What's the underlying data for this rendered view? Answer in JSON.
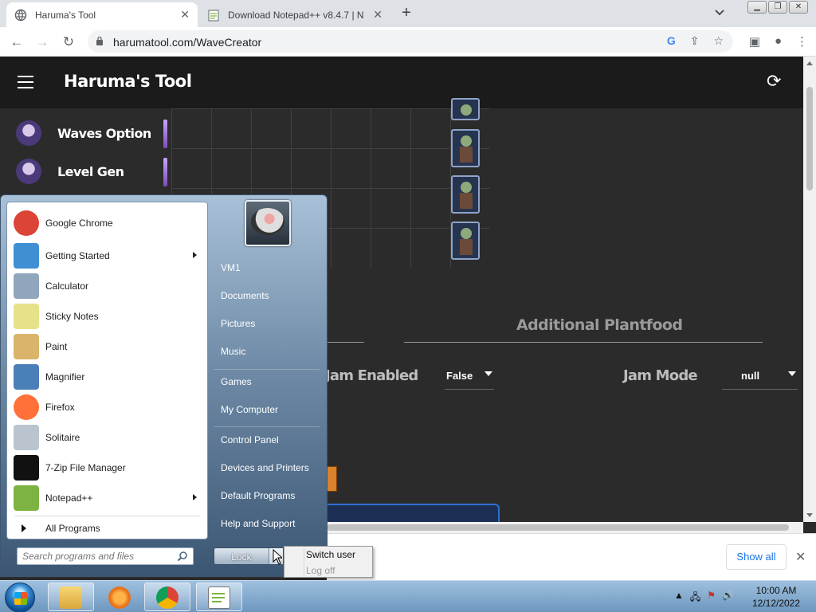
{
  "browser": {
    "tabs": [
      {
        "title": "Haruma's Tool",
        "active": true
      },
      {
        "title": "Download Notepad++ v8.4.7 | N",
        "active": false
      }
    ],
    "new_tab_label": "+",
    "url": "harumatool.com/WaveCreator"
  },
  "app": {
    "title": "Haruma's Tool",
    "sidebar": [
      {
        "label": "Waves Option"
      },
      {
        "label": "Level Gen"
      }
    ],
    "section_title": "Additional Plantfood",
    "fields": [
      {
        "label": "Jam Enabled",
        "value": "False"
      },
      {
        "label": "Jam Mode",
        "value": "null"
      }
    ]
  },
  "downloads": {
    "show_all_label": "Show all",
    "close_glyph": "✕"
  },
  "start_menu": {
    "programs": [
      {
        "label": "Google Chrome",
        "icon": "chrome-icon",
        "color": "#db4437",
        "submenu": false
      },
      {
        "label": "Getting Started",
        "icon": "getting-started-icon",
        "color": "#3f8fd2",
        "submenu": true
      },
      {
        "label": "Calculator",
        "icon": "calculator-icon",
        "color": "#8fa6bd",
        "submenu": false
      },
      {
        "label": "Sticky Notes",
        "icon": "sticky-notes-icon",
        "color": "#e6e28a",
        "submenu": false
      },
      {
        "label": "Paint",
        "icon": "paint-icon",
        "color": "#d9b46a",
        "submenu": false
      },
      {
        "label": "Magnifier",
        "icon": "magnifier-icon",
        "color": "#4b7fb8",
        "submenu": false
      },
      {
        "label": "Firefox",
        "icon": "firefox-icon",
        "color": "#ff7139",
        "submenu": false
      },
      {
        "label": "Solitaire",
        "icon": "solitaire-icon",
        "color": "#b9c4cf",
        "submenu": false
      },
      {
        "label": "7-Zip File Manager",
        "icon": "7zip-icon",
        "color": "#111111",
        "submenu": false
      },
      {
        "label": "Notepad++",
        "icon": "notepad-plus-plus-icon",
        "color": "#7cb342",
        "submenu": true
      }
    ],
    "all_programs": "All Programs",
    "search_placeholder": "Search programs and files",
    "right_links": [
      "VM1",
      "Documents",
      "Pictures",
      "Music",
      "Games",
      "My Computer",
      "Control Panel",
      "Devices and Printers",
      "Default Programs",
      "Help and Support"
    ],
    "lock_label": "Lock",
    "power_menu": [
      {
        "label": "Switch user",
        "enabled": true
      },
      {
        "label": "Log off",
        "enabled": false
      }
    ]
  },
  "taskbar": {
    "clock_time": "10:00 AM",
    "clock_date": "12/12/2022"
  }
}
